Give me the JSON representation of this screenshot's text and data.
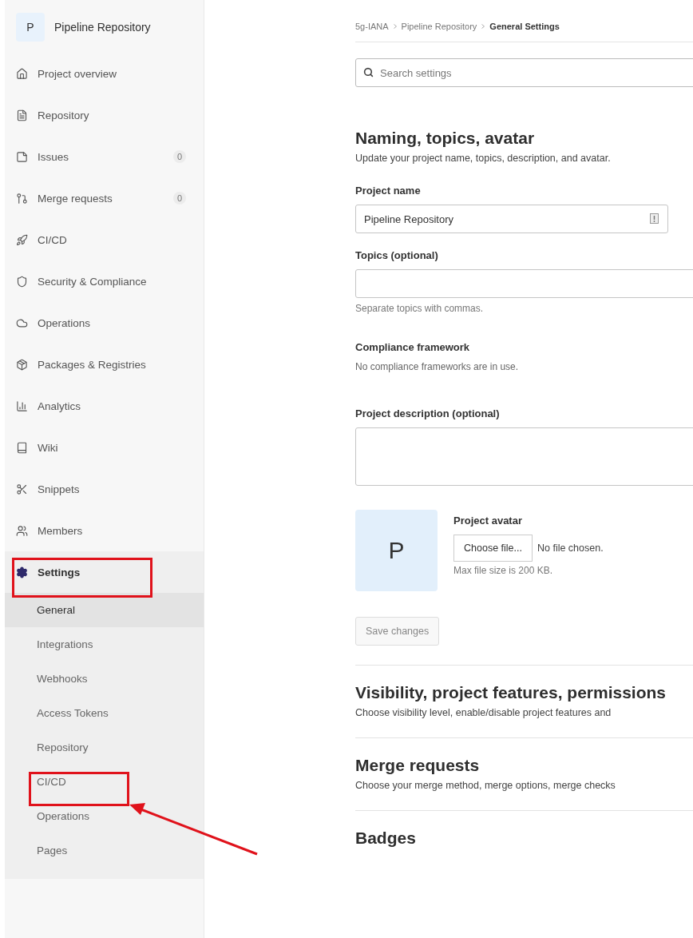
{
  "sidebar": {
    "project": {
      "avatar_letter": "P",
      "title": "Pipeline Repository"
    },
    "items": [
      {
        "label": "Project overview",
        "selected": false
      },
      {
        "label": "Repository",
        "selected": false
      },
      {
        "label": "Issues",
        "count": "0",
        "selected": false
      },
      {
        "label": "Merge requests",
        "count": "0",
        "selected": false
      },
      {
        "label": "CI/CD",
        "selected": false
      },
      {
        "label": "Security & Compliance",
        "selected": false
      },
      {
        "label": "Operations",
        "selected": false
      },
      {
        "label": "Packages & Registries",
        "selected": false
      },
      {
        "label": "Analytics",
        "selected": false
      },
      {
        "label": "Wiki",
        "selected": false
      },
      {
        "label": "Snippets",
        "selected": false
      },
      {
        "label": "Members",
        "selected": false
      },
      {
        "label": "Settings",
        "selected": true,
        "children": [
          {
            "label": "General",
            "selected": true
          },
          {
            "label": "Integrations",
            "selected": false
          },
          {
            "label": "Webhooks",
            "selected": false
          },
          {
            "label": "Access Tokens",
            "selected": false
          },
          {
            "label": "Repository",
            "selected": false
          },
          {
            "label": "CI/CD",
            "selected": false
          },
          {
            "label": "Operations",
            "selected": false
          },
          {
            "label": "Pages",
            "selected": false
          }
        ]
      }
    ]
  },
  "breadcrumb": [
    {
      "label": "5g-IANA",
      "current": false
    },
    {
      "label": "Pipeline Repository",
      "current": false
    },
    {
      "label": "General Settings",
      "current": true
    }
  ],
  "search": {
    "placeholder": "Search settings"
  },
  "sections": [
    {
      "title": "Naming, topics, avatar",
      "description": "Update your project name, topics, description, and avatar."
    },
    {
      "title": "Visibility, project features, permissions",
      "description": "Choose visibility level, enable/disable project features and"
    },
    {
      "title": "Merge requests",
      "description": "Choose your merge method, merge options, merge checks"
    },
    {
      "title": "Badges"
    }
  ],
  "form": {
    "project_name": {
      "label": "Project name",
      "value": "Pipeline Repository"
    },
    "topics": {
      "label": "Topics (optional)",
      "help": "Separate topics with commas."
    },
    "compliance": {
      "label": "Compliance framework",
      "text": "No compliance frameworks are in use."
    },
    "description": {
      "label": "Project description (optional)"
    },
    "avatar": {
      "letter": "P",
      "label": "Project avatar",
      "button": "Choose file...",
      "status": "No file chosen.",
      "help": "Max file size is 200 KB."
    },
    "save_button": {
      "label": "Save changes",
      "disabled": true
    }
  }
}
